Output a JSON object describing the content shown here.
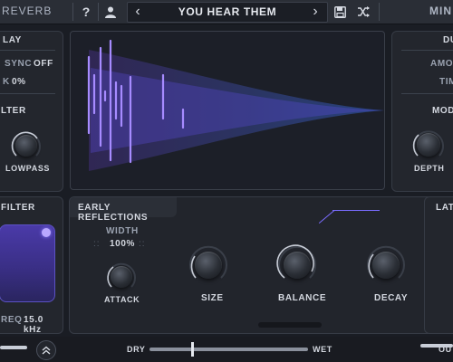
{
  "topbar": {
    "title": "REVERB",
    "help": "?",
    "prev": "‹",
    "preset": "YOU HEAR THEM",
    "next": "›",
    "mode": "MIN"
  },
  "left": {
    "delay_title": "LAY",
    "sync_label": "SYNC",
    "sync_value": "OFF",
    "k_label": "K",
    "k_value": "0%",
    "filter_title": "LTER",
    "lowpass_label": "LOWPASS",
    "bottom_filter_title": "FILTER",
    "freq_label": "REQ",
    "freq_value": "15.0 kHz"
  },
  "right": {
    "mod_title": "DU",
    "amount_label": "AMOU",
    "time_label": "TIM",
    "mode_label": "MOD",
    "depth_label": "DEPTH",
    "late_title": "LAT"
  },
  "early": {
    "title": "EARLY REFLECTIONS",
    "width_label": "WIDTH",
    "width_value": "100%",
    "attack_label": "ATTACK",
    "size_label": "SIZE",
    "balance_label": "BALANCE",
    "decay_label": "DECAY"
  },
  "bottom": {
    "dry_label": "DRY",
    "wet_label": "WET",
    "mix_level": 0.26,
    "out_label": "OU"
  },
  "colors": {
    "accent": "#8a7cff",
    "reflection": "#a68bff"
  }
}
